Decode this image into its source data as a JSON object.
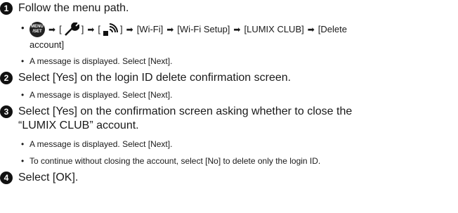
{
  "steps": [
    {
      "num": "1",
      "text": "Follow the menu path."
    },
    {
      "num": "2",
      "text": "Select [Yes] on the login ID delete confirmation screen."
    },
    {
      "num": "3",
      "text": "Select [Yes] on the confirmation screen asking whether to close the",
      "text_cont": "“LUMIX CLUB” account."
    },
    {
      "num": "4",
      "text": "Select [OK]."
    }
  ],
  "menu_path": {
    "bullet": "•",
    "menu_icon_line1": "MENU",
    "menu_icon_line2": "/SET",
    "arrow": "➡",
    "bracket_open": "[",
    "bracket_close": "]",
    "wifi": "[Wi-Fi]",
    "wifi_setup": "[Wi-Fi Setup]",
    "lumix_club": "[LUMIX CLUB]",
    "delete_account_1": "[Delete",
    "delete_account_2": "account]"
  },
  "notes": {
    "step1_note": "A message is displayed. Select [Next].",
    "step2_note": "A message is displayed. Select [Next].",
    "step3_note1": "A message is displayed. Select [Next].",
    "step3_note2": "To continue without closing the account, select [No] to delete only the login ID."
  },
  "icons": [
    "menu-set-icon",
    "wrench-icon",
    "wireless-connection-icon",
    "arrow-right-icon"
  ]
}
